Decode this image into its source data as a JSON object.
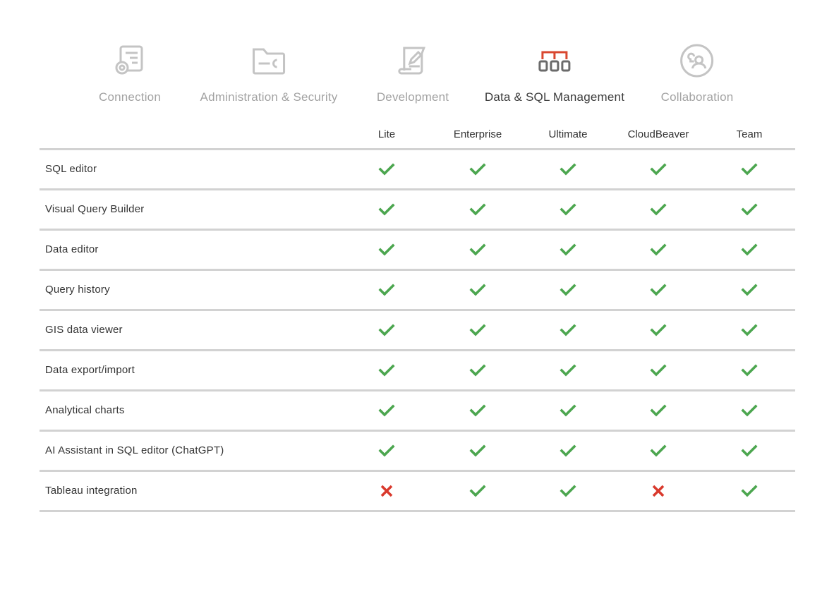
{
  "tabs": [
    {
      "label": "Connection",
      "icon": "connection-settings-icon",
      "active": false
    },
    {
      "label": "Administration & Security",
      "icon": "folder-key-icon",
      "active": false
    },
    {
      "label": "Development",
      "icon": "scroll-pencil-icon",
      "active": false
    },
    {
      "label": "Data & SQL Management",
      "icon": "data-hierarchy-icon",
      "active": true
    },
    {
      "label": "Collaboration",
      "icon": "users-circle-icon",
      "active": false
    }
  ],
  "colors": {
    "accent": "#d9472f",
    "icon_active": "#6b6b6b",
    "icon_inactive": "#c4c4c4",
    "check": "#4ca64f",
    "cross": "#d9392c",
    "divider": "#d2d2d2"
  },
  "table": {
    "columns": [
      "Lite",
      "Enterprise",
      "Ultimate",
      "CloudBeaver",
      "Team"
    ],
    "rows": [
      {
        "feature": "SQL editor",
        "support": [
          true,
          true,
          true,
          true,
          true
        ]
      },
      {
        "feature": "Visual Query Builder",
        "support": [
          true,
          true,
          true,
          true,
          true
        ]
      },
      {
        "feature": "Data editor",
        "support": [
          true,
          true,
          true,
          true,
          true
        ]
      },
      {
        "feature": "Query history",
        "support": [
          true,
          true,
          true,
          true,
          true
        ]
      },
      {
        "feature": "GIS data viewer",
        "support": [
          true,
          true,
          true,
          true,
          true
        ]
      },
      {
        "feature": "Data export/import",
        "support": [
          true,
          true,
          true,
          true,
          true
        ]
      },
      {
        "feature": "Analytical charts",
        "support": [
          true,
          true,
          true,
          true,
          true
        ]
      },
      {
        "feature": "AI Assistant in SQL editor (ChatGPT)",
        "support": [
          true,
          true,
          true,
          true,
          true
        ]
      },
      {
        "feature": "Tableau integration",
        "support": [
          false,
          true,
          true,
          false,
          true
        ]
      }
    ]
  }
}
